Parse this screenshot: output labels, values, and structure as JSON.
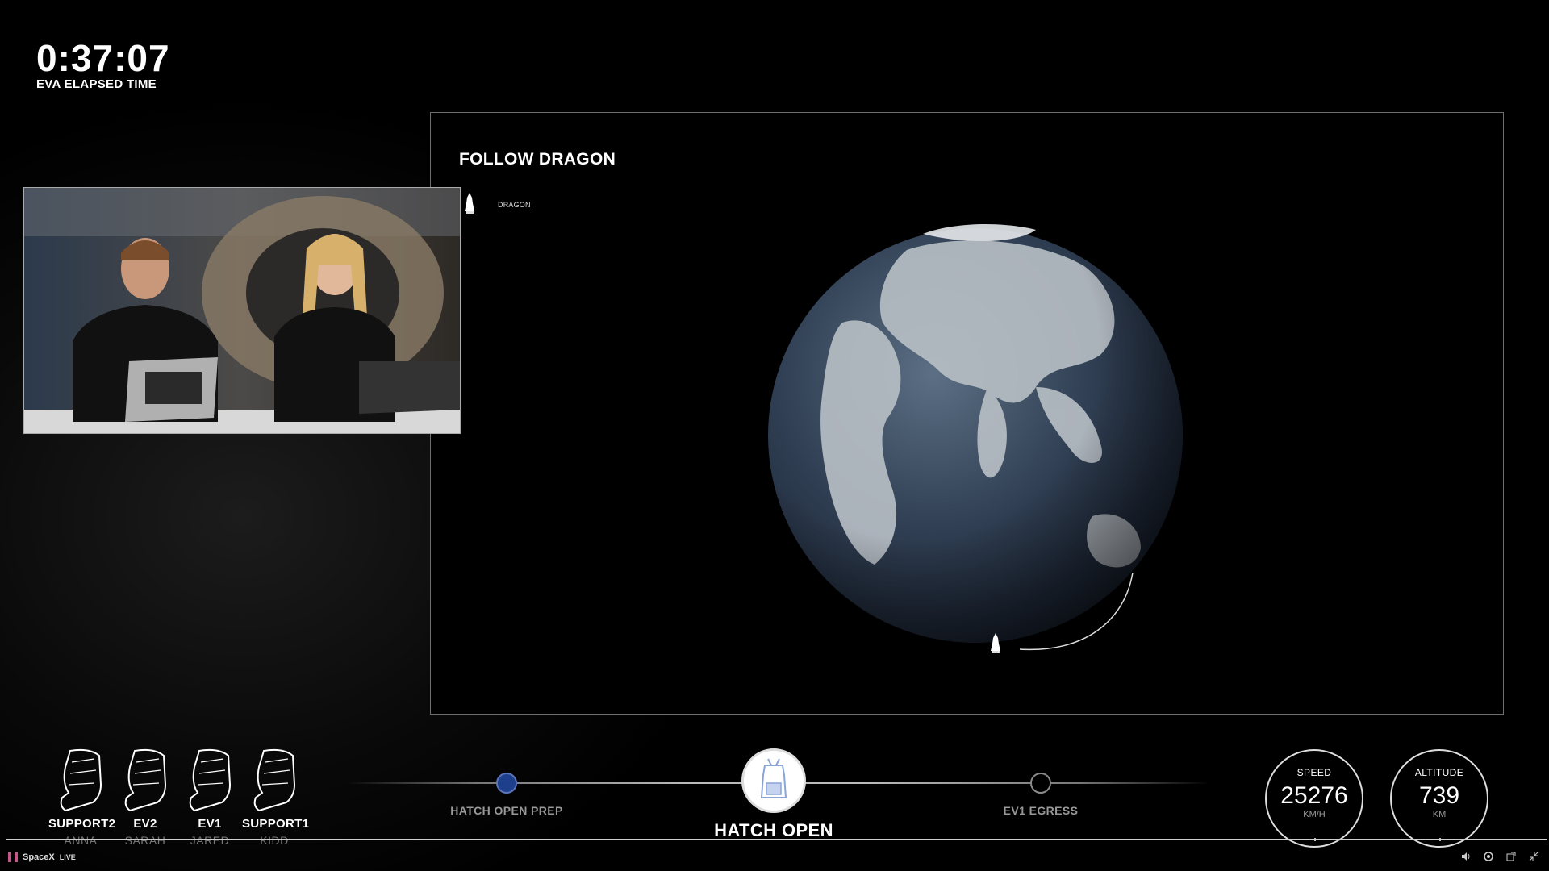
{
  "elapsed": {
    "time": "0:37:07",
    "label": "EVA ELAPSED TIME"
  },
  "tracker": {
    "title": "FOLLOW DRAGON",
    "legend_label": "DRAGON",
    "legend_icon": "dragon-capsule-icon"
  },
  "camera_feed": {
    "description_icon": "live-video-feed"
  },
  "crew": [
    {
      "role": "SUPPORT2",
      "name": "ANNA",
      "icon": "seat-icon"
    },
    {
      "role": "EV2",
      "name": "SARAH",
      "icon": "seat-icon"
    },
    {
      "role": "EV1",
      "name": "JARED",
      "icon": "seat-icon"
    },
    {
      "role": "SUPPORT1",
      "name": "KIDD",
      "icon": "seat-icon"
    }
  ],
  "timeline": {
    "steps": [
      {
        "label": "HATCH OPEN PREP",
        "state": "complete"
      },
      {
        "label": "HATCH OPEN",
        "state": "active"
      },
      {
        "label": "EV1 EGRESS",
        "state": "upcoming"
      }
    ]
  },
  "telemetry": {
    "speed": {
      "label": "SPEED",
      "value": "25276",
      "unit": "KM/H"
    },
    "altitude": {
      "label": "ALTITUDE",
      "value": "739",
      "unit": "KM"
    }
  },
  "player": {
    "brand": "SpaceX",
    "live": "LIVE"
  },
  "colors": {
    "accent_blue": "#1e3f8c",
    "background": "#000000"
  }
}
